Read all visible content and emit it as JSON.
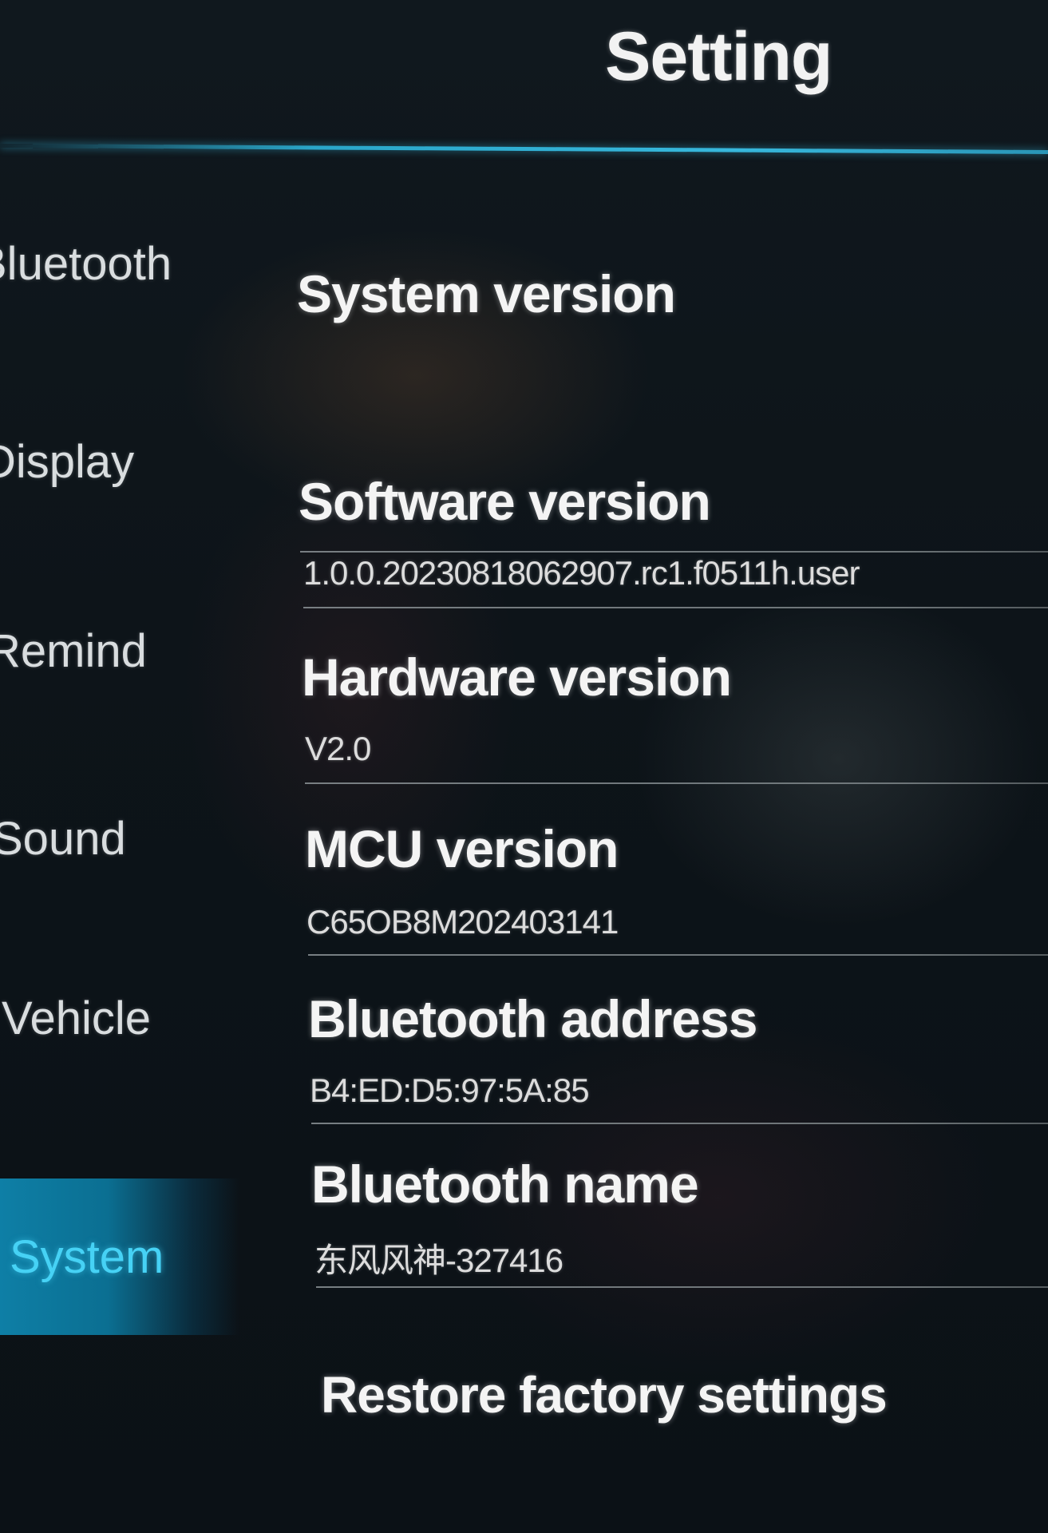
{
  "header": {
    "title": "Setting"
  },
  "sidebar": {
    "items": [
      {
        "label": "Bluetooth",
        "active": false
      },
      {
        "label": "Display",
        "active": false
      },
      {
        "label": "Remind",
        "active": false
      },
      {
        "label": "Sound",
        "active": false
      },
      {
        "label": "Vehicle",
        "active": false
      },
      {
        "label": "System",
        "active": true
      }
    ]
  },
  "system_info": {
    "system_version": {
      "title": "System version",
      "value": ""
    },
    "software_version": {
      "title": "Software version",
      "value": "1.0.0.20230818062907.rc1.f0511h.user"
    },
    "hardware_version": {
      "title": "Hardware version",
      "value": "V2.0"
    },
    "mcu_version": {
      "title": "MCU version",
      "value": "C65OB8M202403141"
    },
    "bluetooth_address": {
      "title": "Bluetooth address",
      "value": "B4:ED:D5:97:5A:85"
    },
    "bluetooth_name": {
      "title": "Bluetooth name",
      "value": "东风风神-327416"
    }
  },
  "actions": {
    "restore_label": "Restore factory settings"
  },
  "colors": {
    "accent": "#2aa6c9",
    "active_text": "#46d2f5",
    "background": "#0c1217"
  }
}
